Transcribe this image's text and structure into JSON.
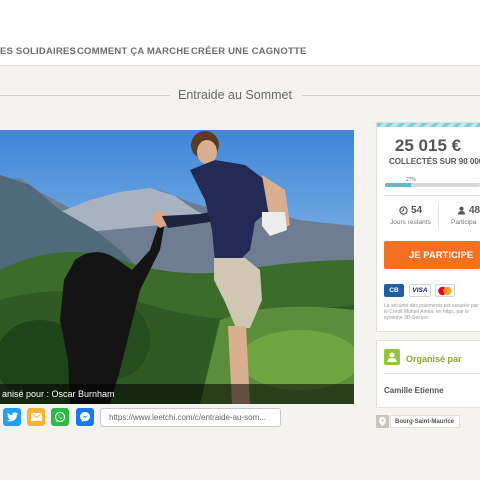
{
  "nav": {
    "items": [
      {
        "label": "ES SOLIDAIRES"
      },
      {
        "label": "COMMENT ÇA MARCHE"
      },
      {
        "label": "CRÉER UNE CAGNOTTE"
      }
    ]
  },
  "page": {
    "title": "Entraide au Sommet"
  },
  "photo": {
    "caption": "anisé pour : Oscar Burnham"
  },
  "share": {
    "buttons": [
      "twitter-icon",
      "email-icon",
      "whatsapp-icon",
      "messenger-icon"
    ],
    "url": "https://www.leetchi.com/c/entraide-au-som..."
  },
  "funding": {
    "amount": "25 015 €",
    "collected_label": "COLLECTÉS SUR 90 000",
    "progress_label": "27%",
    "progress_fraction": 0.27,
    "days_left_value": "54",
    "days_left_label": "Jours restants",
    "participants_value": "48",
    "participants_label": "Participa",
    "cta_label": "JE PARTICIPE",
    "payment_logos": {
      "cb": "CB",
      "visa": "VISA",
      "mastercard": "mastercard-icon"
    },
    "security_text": "La sécurité des paiements est assurée par le Crédit Mutuel Arkéa, en https, par le système 3D-Secure."
  },
  "organizer": {
    "title": "Organisé par",
    "name": "Camille Etienne"
  },
  "location": {
    "label": "Bourg-Saint-Maurice"
  },
  "colors": {
    "accent_orange": "#f37021",
    "progress_teal": "#62b9c2",
    "organizer_green": "#8dc63f",
    "twitter": "#1da1f2",
    "email": "#f9b233",
    "whatsapp": "#2fb846",
    "messenger": "#1877f2"
  }
}
